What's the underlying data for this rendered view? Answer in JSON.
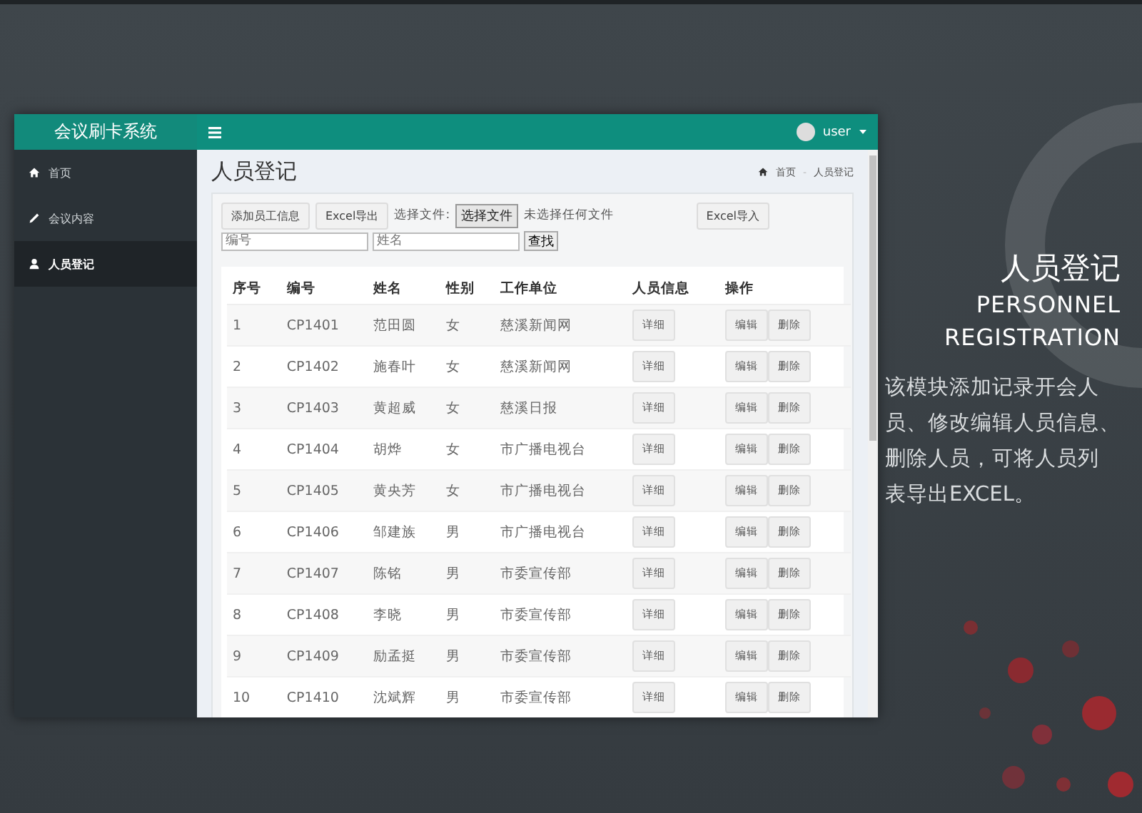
{
  "sidebar": {
    "brand": "会议刷卡系统",
    "items": [
      {
        "label": "首页",
        "selected": false
      },
      {
        "label": "会议内容",
        "selected": false
      },
      {
        "label": "人员登记",
        "selected": true
      }
    ]
  },
  "navbar": {
    "user": "user"
  },
  "page": {
    "title": "人员登记",
    "breadcrumb": [
      "首页",
      "人员登记"
    ],
    "breadcrumb_separator": "-"
  },
  "toolbar": {
    "buttons": [
      "添加员工信息",
      "Excel导出"
    ],
    "file_label": "选择文件:",
    "file_button": "选择文件",
    "file_status": "未选择任何文件",
    "import_button": "Excel导入"
  },
  "search": {
    "fields": [
      {
        "placeholder": "编号"
      },
      {
        "placeholder": "姓名"
      }
    ],
    "button": "查找"
  },
  "table": {
    "columns": [
      "序号",
      "编号",
      "姓名",
      "性别",
      "工作单位",
      "人员信息",
      "操作"
    ],
    "rows": [
      {
        "cells": [
          "1",
          "CP1401",
          "范田圆",
          "女",
          "慈溪新闻网"
        ],
        "detail": "详细",
        "actions": [
          "编辑",
          "删除"
        ]
      },
      {
        "cells": [
          "2",
          "CP1402",
          "施春叶",
          "女",
          "慈溪新闻网"
        ],
        "detail": "详细",
        "actions": [
          "编辑",
          "删除"
        ]
      },
      {
        "cells": [
          "3",
          "CP1403",
          "黄超威",
          "女",
          "慈溪日报"
        ],
        "detail": "详细",
        "actions": [
          "编辑",
          "删除"
        ]
      },
      {
        "cells": [
          "4",
          "CP1404",
          "胡烨",
          "女",
          "市广播电视台"
        ],
        "detail": "详细",
        "actions": [
          "编辑",
          "删除"
        ]
      },
      {
        "cells": [
          "5",
          "CP1405",
          "黄央芳",
          "女",
          "市广播电视台"
        ],
        "detail": "详细",
        "actions": [
          "编辑",
          "删除"
        ]
      },
      {
        "cells": [
          "6",
          "CP1406",
          "邹建族",
          "男",
          "市广播电视台"
        ],
        "detail": "详细",
        "actions": [
          "编辑",
          "删除"
        ]
      },
      {
        "cells": [
          "7",
          "CP1407",
          "陈铭",
          "男",
          "市委宣传部"
        ],
        "detail": "详细",
        "actions": [
          "编辑",
          "删除"
        ]
      },
      {
        "cells": [
          "8",
          "CP1408",
          "李晓",
          "男",
          "市委宣传部"
        ],
        "detail": "详细",
        "actions": [
          "编辑",
          "删除"
        ]
      },
      {
        "cells": [
          "9",
          "CP1409",
          "励孟挺",
          "男",
          "市委宣传部"
        ],
        "detail": "详细",
        "actions": [
          "编辑",
          "删除"
        ]
      },
      {
        "cells": [
          "10",
          "CP1410",
          "沈斌辉",
          "男",
          "市委宣传部"
        ],
        "detail": "详细",
        "actions": [
          "编辑",
          "删除"
        ]
      }
    ]
  },
  "promo": {
    "title": "人员登记",
    "subtitle_lines": [
      "PERSONNEL",
      "REGISTRATION"
    ],
    "description_lines": [
      "该模块添加记录开会人",
      "员、修改编辑人员信息、",
      "删除人员，可将人员列",
      "表导出EXCEL。"
    ]
  }
}
